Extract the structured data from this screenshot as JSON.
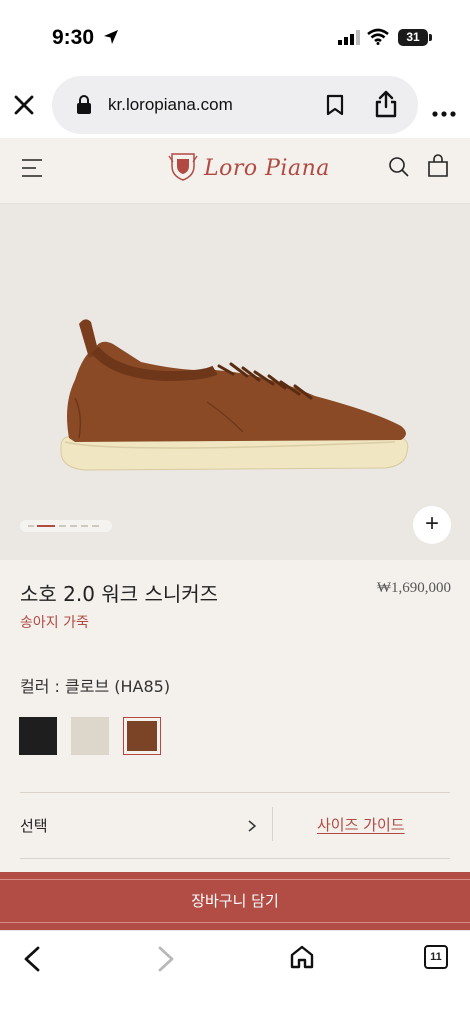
{
  "status_bar": {
    "time": "9:30",
    "battery": "31"
  },
  "browser": {
    "url": "kr.loropiana.com"
  },
  "site": {
    "brand": "Loro Piana"
  },
  "product": {
    "name": "소호 2.0 워크 스니커즈",
    "price": "₩1,690,000",
    "material": "송아지 가죽",
    "color_label": "컬러 : 클로브 (HA85)",
    "swatches": [
      {
        "name": "black",
        "color": "#1e1e1e"
      },
      {
        "name": "cream",
        "color": "#ddd6cb"
      },
      {
        "name": "clove",
        "color": "#7c4426",
        "selected": true
      }
    ],
    "image_slides": 6,
    "active_slide": 2
  },
  "size": {
    "select_label": "선택",
    "size_guide": "사이즈 가이드"
  },
  "cart": {
    "label": "장바구니 담기"
  },
  "toolbar": {
    "tab_count": "11"
  },
  "colors": {
    "accent": "#b04a43",
    "cart_button": "#b24d45"
  }
}
